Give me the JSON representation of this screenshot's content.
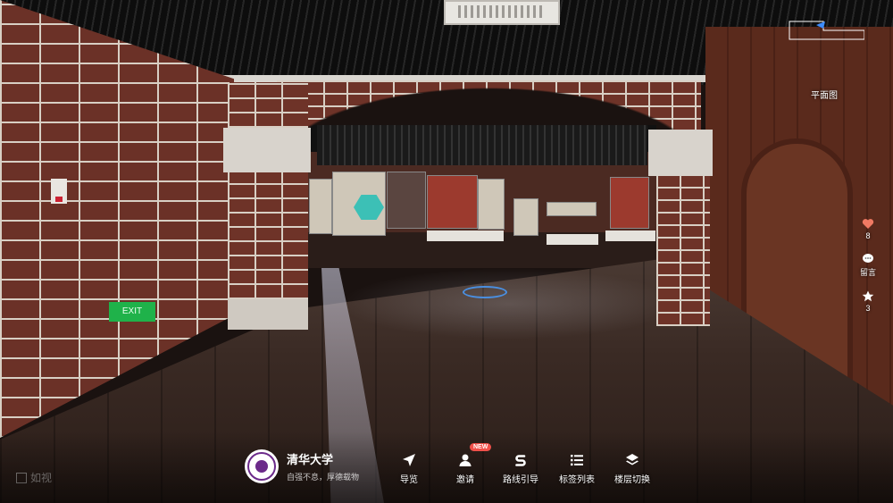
{
  "floorplan": {
    "label": "平面图"
  },
  "side_actions": {
    "like": {
      "icon": "heart-icon",
      "count": "8",
      "color": "#f07a63"
    },
    "comment": {
      "icon": "comment-icon",
      "label": "留言"
    },
    "favorite": {
      "icon": "star-icon",
      "count": "3"
    }
  },
  "watermark": {
    "text": "如视"
  },
  "brand": {
    "name": "清华大学",
    "slogan": "自强不息，厚德载物",
    "logo_icon": "university-seal-icon",
    "logo_color": "#6b2a8a"
  },
  "nav": {
    "browse": {
      "label": "导览",
      "icon": "navigation-arrow-icon"
    },
    "invite": {
      "label": "邀请",
      "icon": "user-icon",
      "badge": "NEW",
      "badge_color": "#f0504a"
    },
    "route": {
      "label": "路线引导",
      "icon": "route-s-icon"
    },
    "tags": {
      "label": "标签列表",
      "icon": "list-icon"
    },
    "floors": {
      "label": "楼层切换",
      "icon": "layers-icon"
    }
  },
  "scene": {
    "exit_sign": "EXIT"
  }
}
